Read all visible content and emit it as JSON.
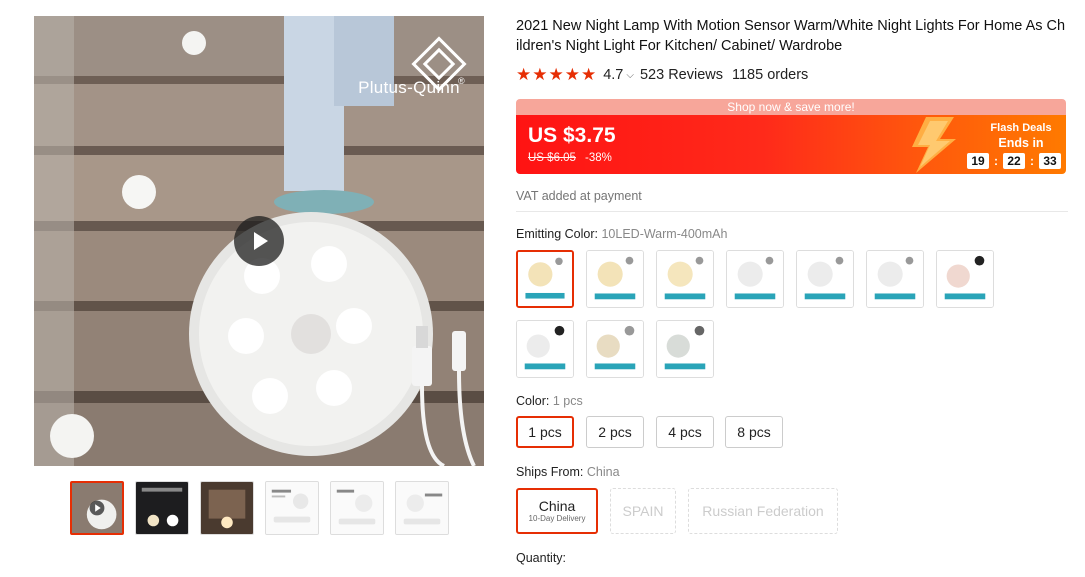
{
  "product": {
    "title": "2021 New Night Lamp With Motion Sensor Warm/White Night Lights For Home As Children's Night Light For Kitchen/ Cabinet/ Wardrobe",
    "stars": "★★★★★",
    "rating": "4.7",
    "reviews": "523 Reviews",
    "orders": "1185 orders"
  },
  "gallery": {
    "brand": "Plutus-Quinn",
    "brand_mark": "®",
    "thumb_count": 6,
    "active_thumb": 0
  },
  "price": {
    "promo_banner": "Shop now & save more!",
    "current": "US $3.75",
    "original": "US $6.05",
    "discount": "-38%",
    "flash_label": "Flash Deals",
    "ends_in_label": "Ends in",
    "timer": {
      "hours": "19",
      "minutes": "22",
      "seconds": "33"
    }
  },
  "vat_note": "VAT added at payment",
  "emitting_color": {
    "label": "Emitting Color:",
    "selected": "10LED-Warm-400mAh",
    "swatch_count": 10,
    "active_index": 0
  },
  "color": {
    "label": "Color:",
    "selected": "1 pcs",
    "options": [
      "1 pcs",
      "2 pcs",
      "4 pcs",
      "8 pcs"
    ]
  },
  "ships_from": {
    "label": "Ships From:",
    "selected": "China",
    "options": [
      {
        "name": "China",
        "sub": "10-Day Delivery"
      },
      {
        "name": "SPAIN"
      },
      {
        "name": "Russian Federation"
      }
    ]
  },
  "quantity": {
    "label": "Quantity:"
  },
  "colors": {
    "accent": "#e62e04",
    "price_red": "#ff1313",
    "flash_orange": "#ff7a00"
  }
}
